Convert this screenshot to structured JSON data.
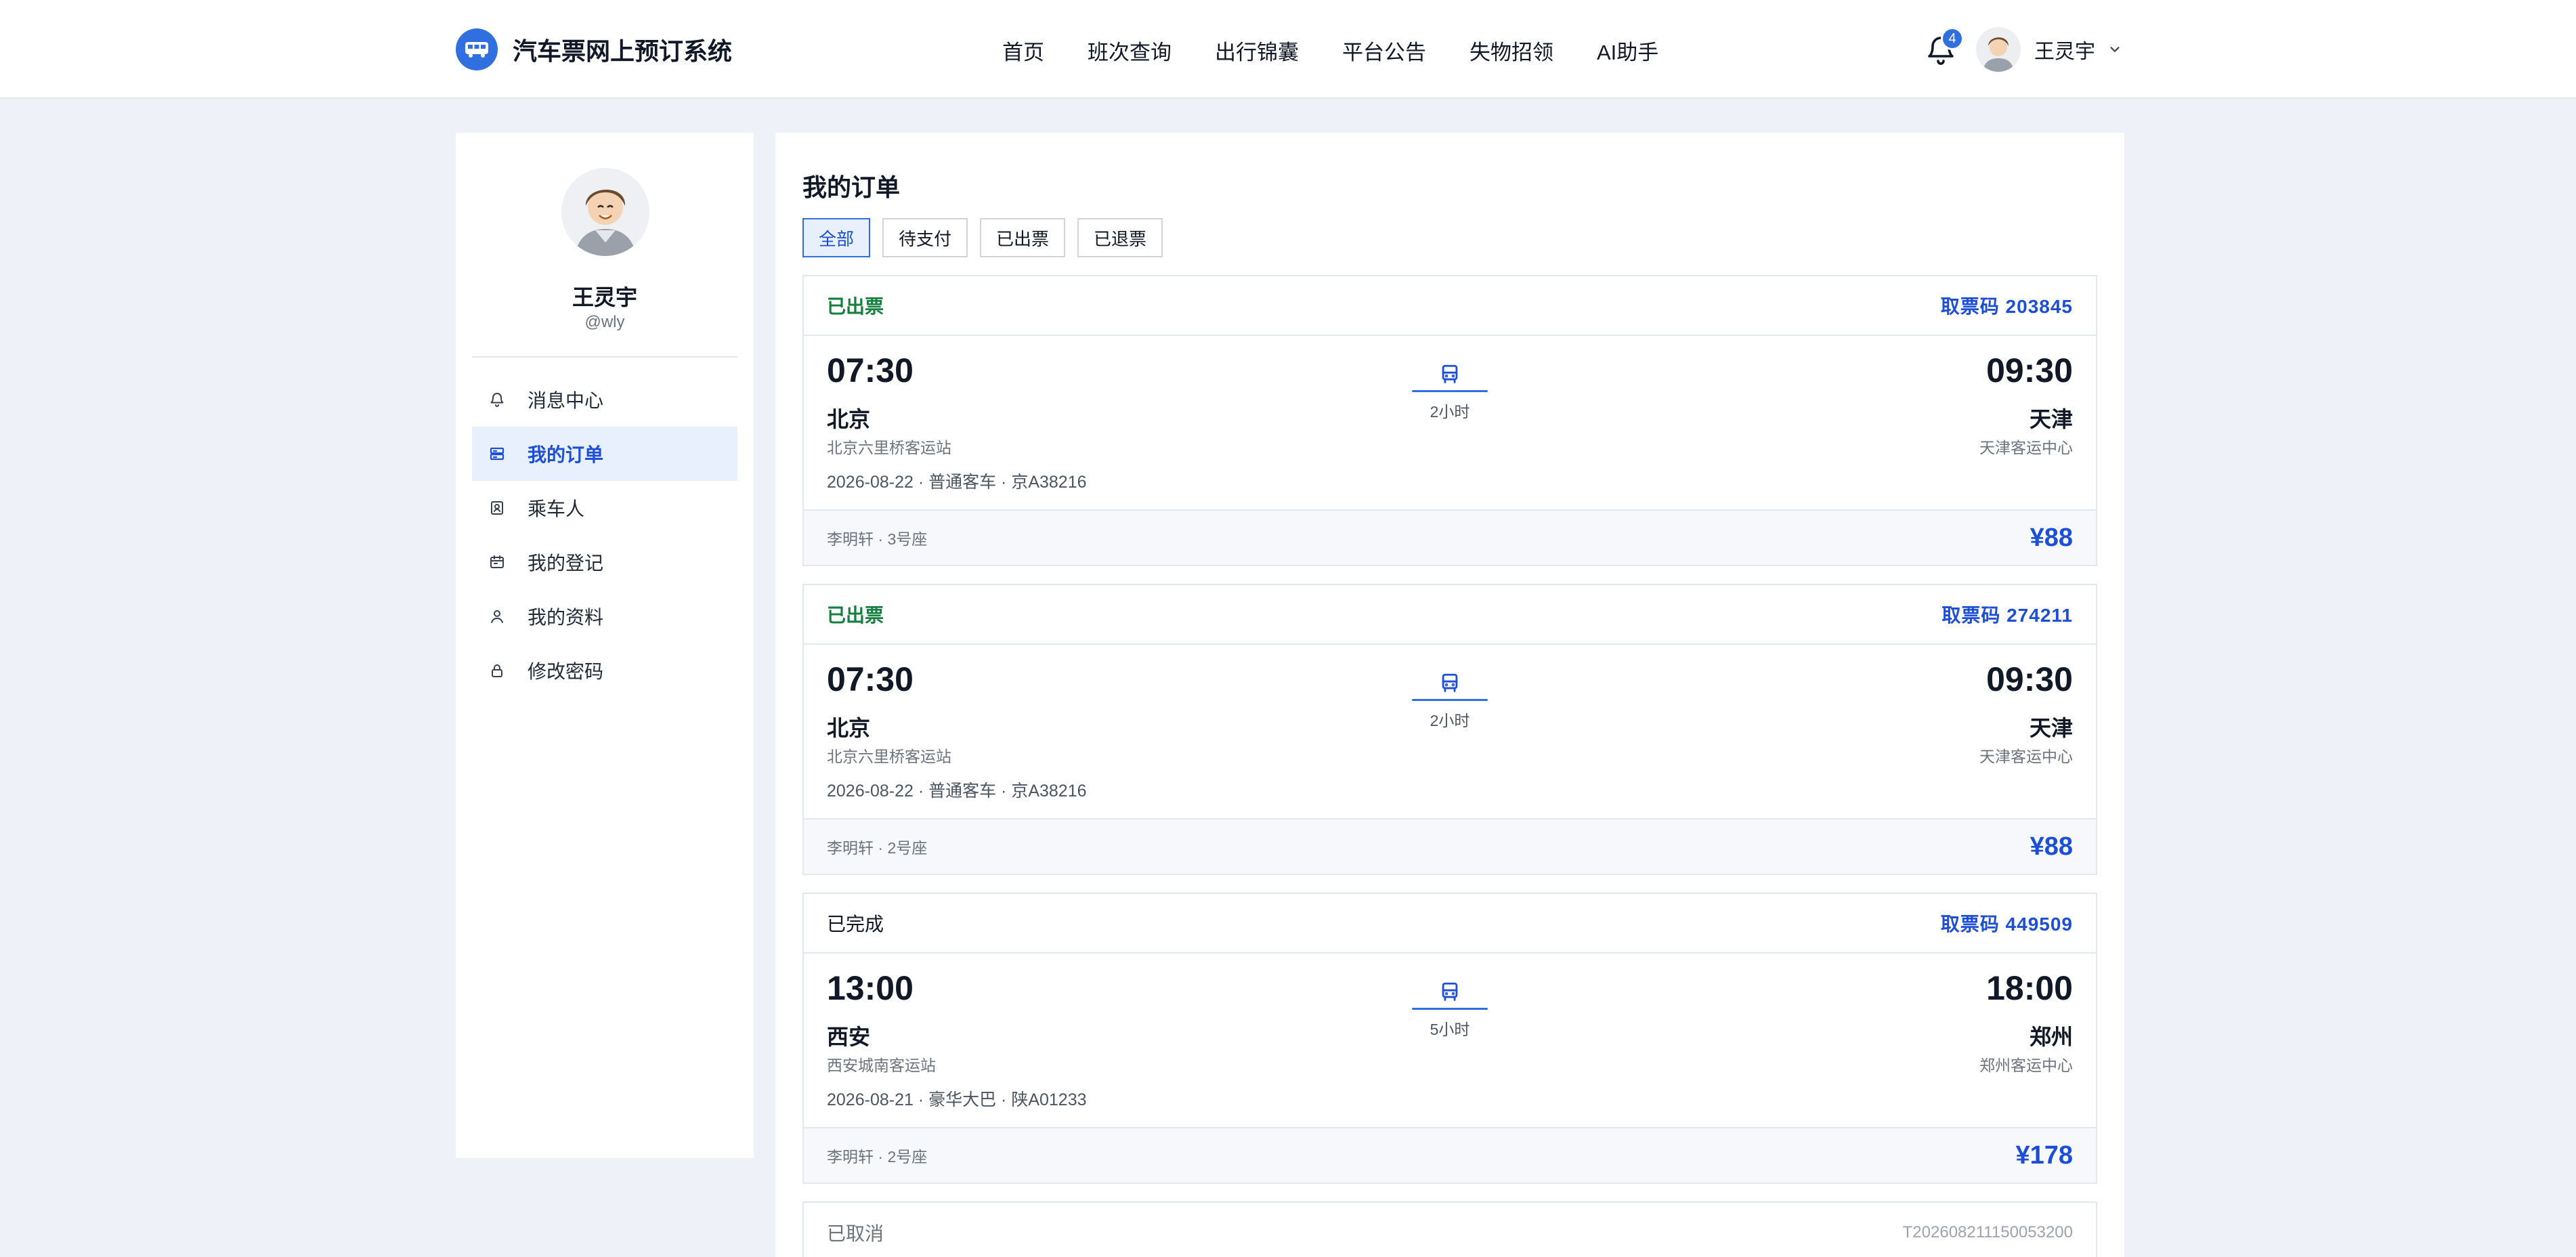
{
  "header": {
    "app_title": "汽车票网上预订系统",
    "nav": [
      "首页",
      "班次查询",
      "出行锦囊",
      "平台公告",
      "失物招领",
      "AI助手"
    ],
    "notification_count": "4",
    "user_name": "王灵宇"
  },
  "sidebar": {
    "profile_name": "王灵宇",
    "profile_handle": "@wly",
    "items": [
      {
        "label": "消息中心",
        "icon": "bell-icon"
      },
      {
        "label": "我的订单",
        "icon": "ticket-icon"
      },
      {
        "label": "乘车人",
        "icon": "id-card-icon"
      },
      {
        "label": "我的登记",
        "icon": "calendar-box-icon"
      },
      {
        "label": "我的资料",
        "icon": "user-icon"
      },
      {
        "label": "修改密码",
        "icon": "lock-icon"
      }
    ],
    "active_index": 1
  },
  "main": {
    "title": "我的订单",
    "filters": [
      "全部",
      "待支付",
      "已出票",
      "已退票"
    ],
    "active_filter": 0,
    "orders": [
      {
        "status": "已出票",
        "code_label": "取票码 203845",
        "dep_time": "07:30",
        "dep_city": "北京",
        "dep_station": "北京六里桥客运站",
        "meta": "2026-08-22 · 普通客车 · 京A38216",
        "duration": "2小时",
        "arr_time": "09:30",
        "arr_city": "天津",
        "arr_station": "天津客运中心",
        "passenger": "李明轩 · 3号座",
        "price": "¥88"
      },
      {
        "status": "已出票",
        "code_label": "取票码 274211",
        "dep_time": "07:30",
        "dep_city": "北京",
        "dep_station": "北京六里桥客运站",
        "meta": "2026-08-22 · 普通客车 · 京A38216",
        "duration": "2小时",
        "arr_time": "09:30",
        "arr_city": "天津",
        "arr_station": "天津客运中心",
        "passenger": "李明轩 · 2号座",
        "price": "¥88"
      },
      {
        "status": "已完成",
        "code_label": "取票码 449509",
        "dep_time": "13:00",
        "dep_city": "西安",
        "dep_station": "西安城南客运站",
        "meta": "2026-08-21 · 豪华大巴 · 陕A01233",
        "duration": "5小时",
        "arr_time": "18:00",
        "arr_city": "郑州",
        "arr_station": "郑州客运中心",
        "passenger": "李明轩 · 2号座",
        "price": "¥178"
      }
    ],
    "cancelled_order": {
      "status": "已取消",
      "order_no": "T202608211150053200"
    }
  },
  "colors": {
    "accent": "#2f6fe0",
    "price": "#1d4ed8",
    "issued": "#15803d",
    "page_bg": "#eef2f8"
  }
}
